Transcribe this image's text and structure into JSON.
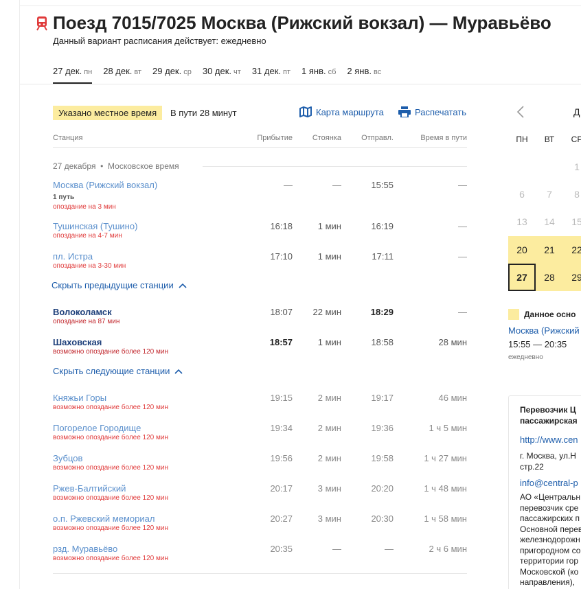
{
  "header": {
    "title": "Поезд 7015/7025 Москва (Рижский вокзал) — Муравьёво",
    "subtitle": "Данный вариант расписания действует: ежедневно",
    "accent_color": "#e03a3a"
  },
  "date_tabs": [
    {
      "day": "27 дек.",
      "weekday": "пн",
      "active": true
    },
    {
      "day": "28 дек.",
      "weekday": "вт"
    },
    {
      "day": "29 дек.",
      "weekday": "ср"
    },
    {
      "day": "30 дек.",
      "weekday": "чт"
    },
    {
      "day": "31 дек.",
      "weekday": "пт"
    },
    {
      "day": "1 янв.",
      "weekday": "сб"
    },
    {
      "day": "2 янв.",
      "weekday": "вс"
    }
  ],
  "toolbar": {
    "local_time_badge": "Указано местное время",
    "duration": "В пути 28 минут",
    "route_map": "Карта маршрута",
    "print": "Распечатать"
  },
  "table": {
    "headers": {
      "station": "Станция",
      "arrival": "Прибытие",
      "stop": "Стоянка",
      "departure": "Отправл.",
      "travel_time": "Время в пути"
    },
    "date_header": "27 декабря",
    "timezone": "Московское время",
    "hide_previous": "Скрыть предыдущие станции",
    "hide_next": "Скрыть следующие станции",
    "rows": [
      {
        "name": "Москва (Рижский вокзал)",
        "platform": "1 путь",
        "delay": "опоздание на 3 мин",
        "arrival": "—",
        "stop": "—",
        "departure": "15:55",
        "time": "—"
      },
      {
        "name": "Тушинская (Тушино)",
        "delay": "опоздание на 4-7 мин",
        "arrival": "16:18",
        "stop": "1 мин",
        "departure": "16:19",
        "time": "—"
      },
      {
        "name": "пл. Истра",
        "delay": "опоздание на 3-30 мин",
        "arrival": "17:10",
        "stop": "1 мин",
        "departure": "17:11",
        "time": "—"
      },
      {
        "name": "Волоколамск",
        "delay": "опоздание на 87 мин",
        "arrival": "18:07",
        "stop": "22 мин",
        "departure": "18:29",
        "time": "—"
      },
      {
        "name": "Шаховская",
        "delay": "возможно опоздание более 120 мин",
        "arrival": "18:57",
        "stop": "1 мин",
        "departure": "18:58",
        "time": "28 мин"
      },
      {
        "name": "Княжьи Горы",
        "delay": "возможно опоздание более 120 мин",
        "arrival": "19:15",
        "stop": "2 мин",
        "departure": "19:17",
        "time": "46 мин"
      },
      {
        "name": "Погорелое Городище",
        "delay": "возможно опоздание более 120 мин",
        "arrival": "19:34",
        "stop": "2 мин",
        "departure": "19:36",
        "time": "1 ч 5 мин"
      },
      {
        "name": "Зубцов",
        "delay": "возможно опоздание более 120 мин",
        "arrival": "19:56",
        "stop": "2 мин",
        "departure": "19:58",
        "time": "1 ч 27 мин"
      },
      {
        "name": "Ржев-Балтийский",
        "delay": "возможно опоздание более 120 мин",
        "arrival": "20:17",
        "stop": "3 мин",
        "departure": "20:20",
        "time": "1 ч 48 мин"
      },
      {
        "name": "о.п. Ржевский мемориал",
        "delay": "возможно опоздание более 120 мин",
        "arrival": "20:27",
        "stop": "3 мин",
        "departure": "20:30",
        "time": "1 ч 58 мин"
      },
      {
        "name": "рзд. Муравьёво",
        "delay": "возможно опоздание более 120 мин",
        "arrival": "20:35",
        "stop": "—",
        "departure": "—",
        "time": "2 ч 6 мин"
      }
    ]
  },
  "calendar": {
    "month_partial": "Д",
    "weekdays": [
      "ПН",
      "ВТ",
      "СР"
    ],
    "rows": [
      [
        "",
        "",
        "1"
      ],
      [
        "6",
        "7",
        "8"
      ],
      [
        "13",
        "14",
        "15"
      ],
      [
        "20",
        "21",
        "22"
      ],
      [
        "27",
        "28",
        "29"
      ]
    ],
    "legend": "Данное осно",
    "route_link": "Москва (Рижский",
    "route_time": "15:55 — 20:35",
    "route_days": "ежедневно",
    "highlight_color": "#fcec9f"
  },
  "carrier": {
    "title_line1": "Перевозчик Ц",
    "title_line2": "пассажирская",
    "website": "http://www.cen",
    "address_line1": "г. Москва, ул.Н",
    "address_line2": "стр.22",
    "email": "info@central-p",
    "desc_lines": [
      "АО «Центральн",
      "перевозчик сре",
      "пассажирских п",
      "Основной перев",
      "железнодорожн",
      "пригородном со",
      "территории гор",
      "Московской (ко",
      "направления),"
    ]
  }
}
